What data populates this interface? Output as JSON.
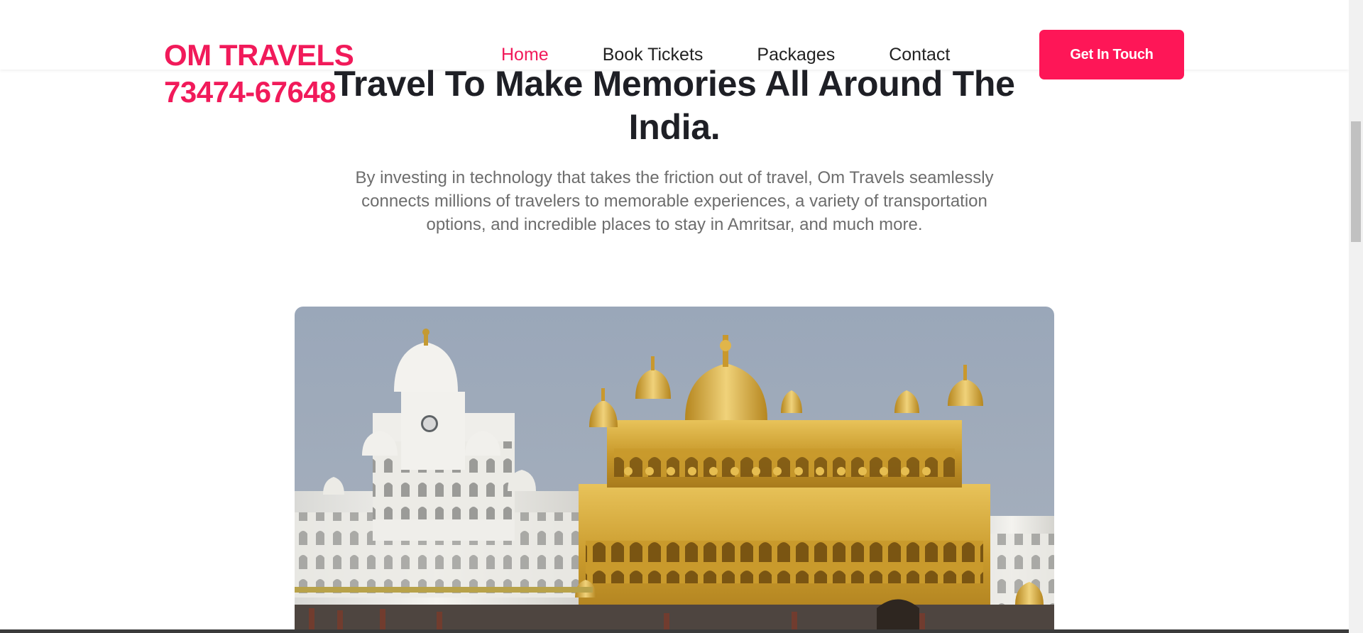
{
  "brand": {
    "name": "OM TRAVELS",
    "phone": "73474-67648"
  },
  "nav": {
    "items": [
      {
        "label": "Home",
        "active": true
      },
      {
        "label": "Book Tickets",
        "active": false
      },
      {
        "label": "Packages",
        "active": false
      },
      {
        "label": "Contact",
        "active": false
      }
    ]
  },
  "cta": {
    "label": "Get In Touch"
  },
  "hero": {
    "title": "Travel To Make Memories All Around The India.",
    "description": "By investing in technology that takes the friction out of travel, Om Travels seamlessly connects millions of travelers to memorable experiences, a variety of transportation options, and incredible places to stay in Amritsar, and much more."
  },
  "colors": {
    "accent": "#f11a5a",
    "cta_bg": "#fe1657",
    "text": "#1e1f25",
    "muted": "#6d6d6d"
  }
}
